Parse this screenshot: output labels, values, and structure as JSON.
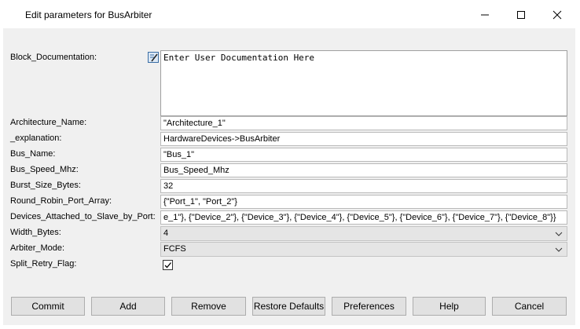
{
  "window": {
    "title": "Edit parameters for BusArbiter",
    "controls": [
      "minimize",
      "maximize",
      "close"
    ]
  },
  "fields": {
    "block_documentation": {
      "label": "Block_Documentation:",
      "value": "Enter User Documentation Here",
      "icon": "edit-document-icon"
    },
    "architecture_name": {
      "label": "Architecture_Name:",
      "value": "\"Architecture_1\""
    },
    "explanation": {
      "label": "_explanation:",
      "value": "HardwareDevices->BusArbiter"
    },
    "bus_name": {
      "label": "Bus_Name:",
      "value": "\"Bus_1\""
    },
    "bus_speed_mhz": {
      "label": "Bus_Speed_Mhz:",
      "value": "Bus_Speed_Mhz"
    },
    "burst_size_bytes": {
      "label": "Burst_Size_Bytes:",
      "value": "32"
    },
    "round_robin_port_array": {
      "label": "Round_Robin_Port_Array:",
      "value": "{\"Port_1\", \"Port_2\"}"
    },
    "devices_attached": {
      "label": "Devices_Attached_to_Slave_by_Port:",
      "value": "e_1\"}, {\"Device_2\"}, {\"Device_3\"}, {\"Device_4\"}, {\"Device_5\"}, {\"Device_6\"}, {\"Device_7\"}, {\"Device_8\"}}"
    },
    "width_bytes": {
      "label": "Width_Bytes:",
      "value": "4"
    },
    "arbiter_mode": {
      "label": "Arbiter_Mode:",
      "value": "FCFS"
    },
    "split_retry_flag": {
      "label": "Split_Retry_Flag:",
      "checked": true
    }
  },
  "buttons": {
    "commit": "Commit",
    "add": "Add",
    "remove": "Remove",
    "restore_defaults": "Restore Defaults",
    "preferences": "Preferences",
    "help": "Help",
    "cancel": "Cancel"
  }
}
